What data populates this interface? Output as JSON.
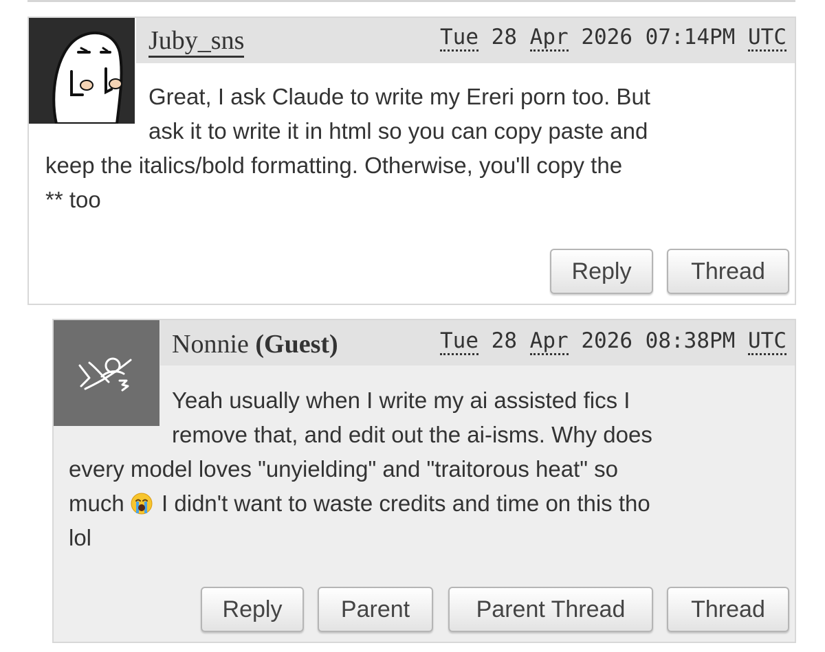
{
  "comments": [
    {
      "username": "Juby_sns",
      "is_guest": false,
      "timestamp": {
        "weekday": "Tue",
        "day": "28",
        "month": "Apr",
        "year": "2026",
        "time": "07:14PM",
        "zone": "UTC"
      },
      "body_lines": [
        "Great, I ask Claude to write my Ereri porn too. But",
        "ask it to write it in html so you can copy paste and",
        "keep the italics/bold formatting. Otherwise, you'll copy the",
        "** too"
      ],
      "buttons": [
        "Reply",
        "Thread"
      ]
    },
    {
      "username": "Nonnie",
      "guest_label": "(Guest)",
      "is_guest": true,
      "timestamp": {
        "weekday": "Tue",
        "day": "28",
        "month": "Apr",
        "year": "2026",
        "time": "08:38PM",
        "zone": "UTC"
      },
      "body_lines": [
        "Yeah usually when I write my ai assisted fics I",
        "remove that, and edit out the ai-isms. Why does",
        "every model loves \"unyielding\" and \"traitorous heat\" so",
        "much",
        "I didn't want to waste credits and time on this tho",
        "lol"
      ],
      "emoji": "loudly-crying-face",
      "buttons": [
        "Reply",
        "Parent",
        "Parent Thread",
        "Thread"
      ]
    }
  ]
}
